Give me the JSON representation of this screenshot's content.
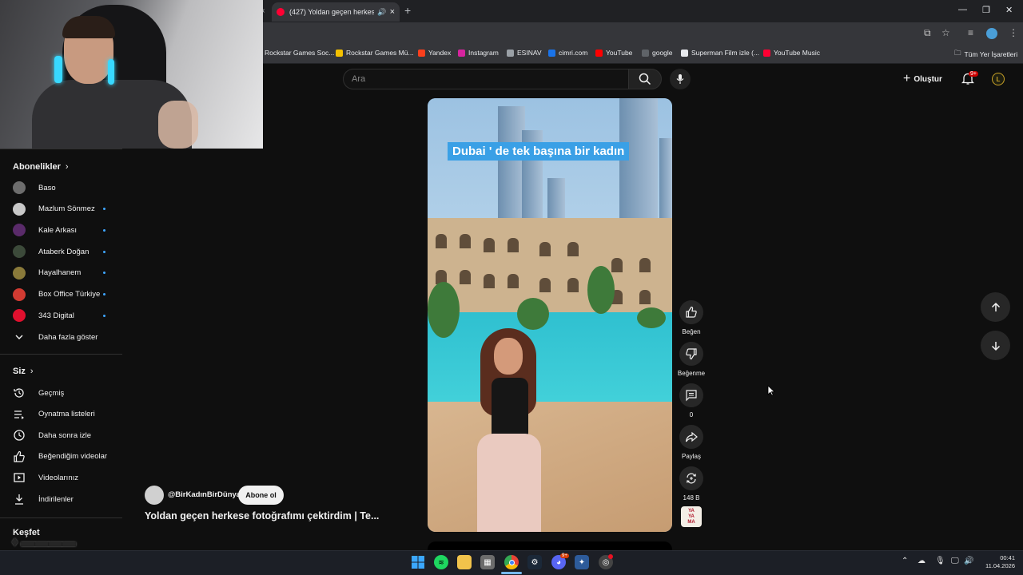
{
  "browser": {
    "tab_title": "(427) Yoldan geçen herkese",
    "window_controls": [
      "minimize-icon",
      "restore-icon",
      "close-icon"
    ],
    "bookmarks": [
      {
        "label": "Rockstar Games Soc...",
        "color": "#f4a300"
      },
      {
        "label": "Rockstar Games Mü...",
        "color": "#f4c100"
      },
      {
        "label": "Yandex",
        "color": "#fc3f1d"
      },
      {
        "label": "Instagram",
        "color": "#d6249f"
      },
      {
        "label": "ESINAV",
        "color": "#9aa0a6"
      },
      {
        "label": "cimri.com",
        "color": "#1a73e8"
      },
      {
        "label": "YouTube",
        "color": "#ff0000"
      },
      {
        "label": "google",
        "color": "#5f6368"
      },
      {
        "label": "Superman Film izle (...",
        "color": "#e8eaed"
      },
      {
        "label": "YouTube Music",
        "color": "#ff0033"
      }
    ],
    "all_bookmarks": "Tüm Yer İşaretleri"
  },
  "youtube": {
    "search_placeholder": "Ara",
    "create_label": "Oluştur",
    "notif_count": "9+",
    "user_initial": "L"
  },
  "sidebar": {
    "subs_title": "Abonelikler",
    "subscriptions": [
      {
        "name": "Baso",
        "color": "#6d6d6d",
        "dot": false
      },
      {
        "name": "Mazlum Sönmez",
        "color": "#c8c8c8",
        "dot": true
      },
      {
        "name": "Kale Arkası",
        "color": "#5a2b6a",
        "dot": true
      },
      {
        "name": "Ataberk Doğan",
        "color": "#3c4a3a",
        "dot": true
      },
      {
        "name": "Hayalhanem",
        "color": "#8a7a3a",
        "dot": true
      },
      {
        "name": "Box Office Türkiye",
        "color": "#d23b32",
        "dot": true
      },
      {
        "name": "343 Digital",
        "color": "#e0102e",
        "dot": true
      }
    ],
    "show_more": "Daha fazla göster",
    "you_title": "Siz",
    "you_items": [
      {
        "label": "Geçmiş",
        "icon": "history-icon"
      },
      {
        "label": "Oynatma listeleri",
        "icon": "playlist-icon"
      },
      {
        "label": "Daha sonra izle",
        "icon": "clock-icon"
      },
      {
        "label": "Beğendiğim videolar",
        "icon": "thumb-up-icon"
      },
      {
        "label": "Videolarınız",
        "icon": "video-icon"
      },
      {
        "label": "İndirilenler",
        "icon": "download-icon"
      }
    ],
    "explore_title": "Keşfet"
  },
  "short": {
    "caption": "Dubai ' de tek başına bir kadın",
    "channel": "@BirKadınBirDünya",
    "subscribe": "Abone ol",
    "title": "Yoldan geçen herkese fotoğrafımı çektirdim | Te...",
    "actions": {
      "like": "Beğen",
      "dislike": "Beğenme",
      "comments": "0",
      "share": "Paylaş",
      "remix": "148 B"
    },
    "sound_thumb_text": [
      "YA",
      "YA",
      "MA"
    ]
  },
  "taskbar": {
    "time": "00:41",
    "date": "11.04.2026",
    "discord_badge": "9+"
  }
}
